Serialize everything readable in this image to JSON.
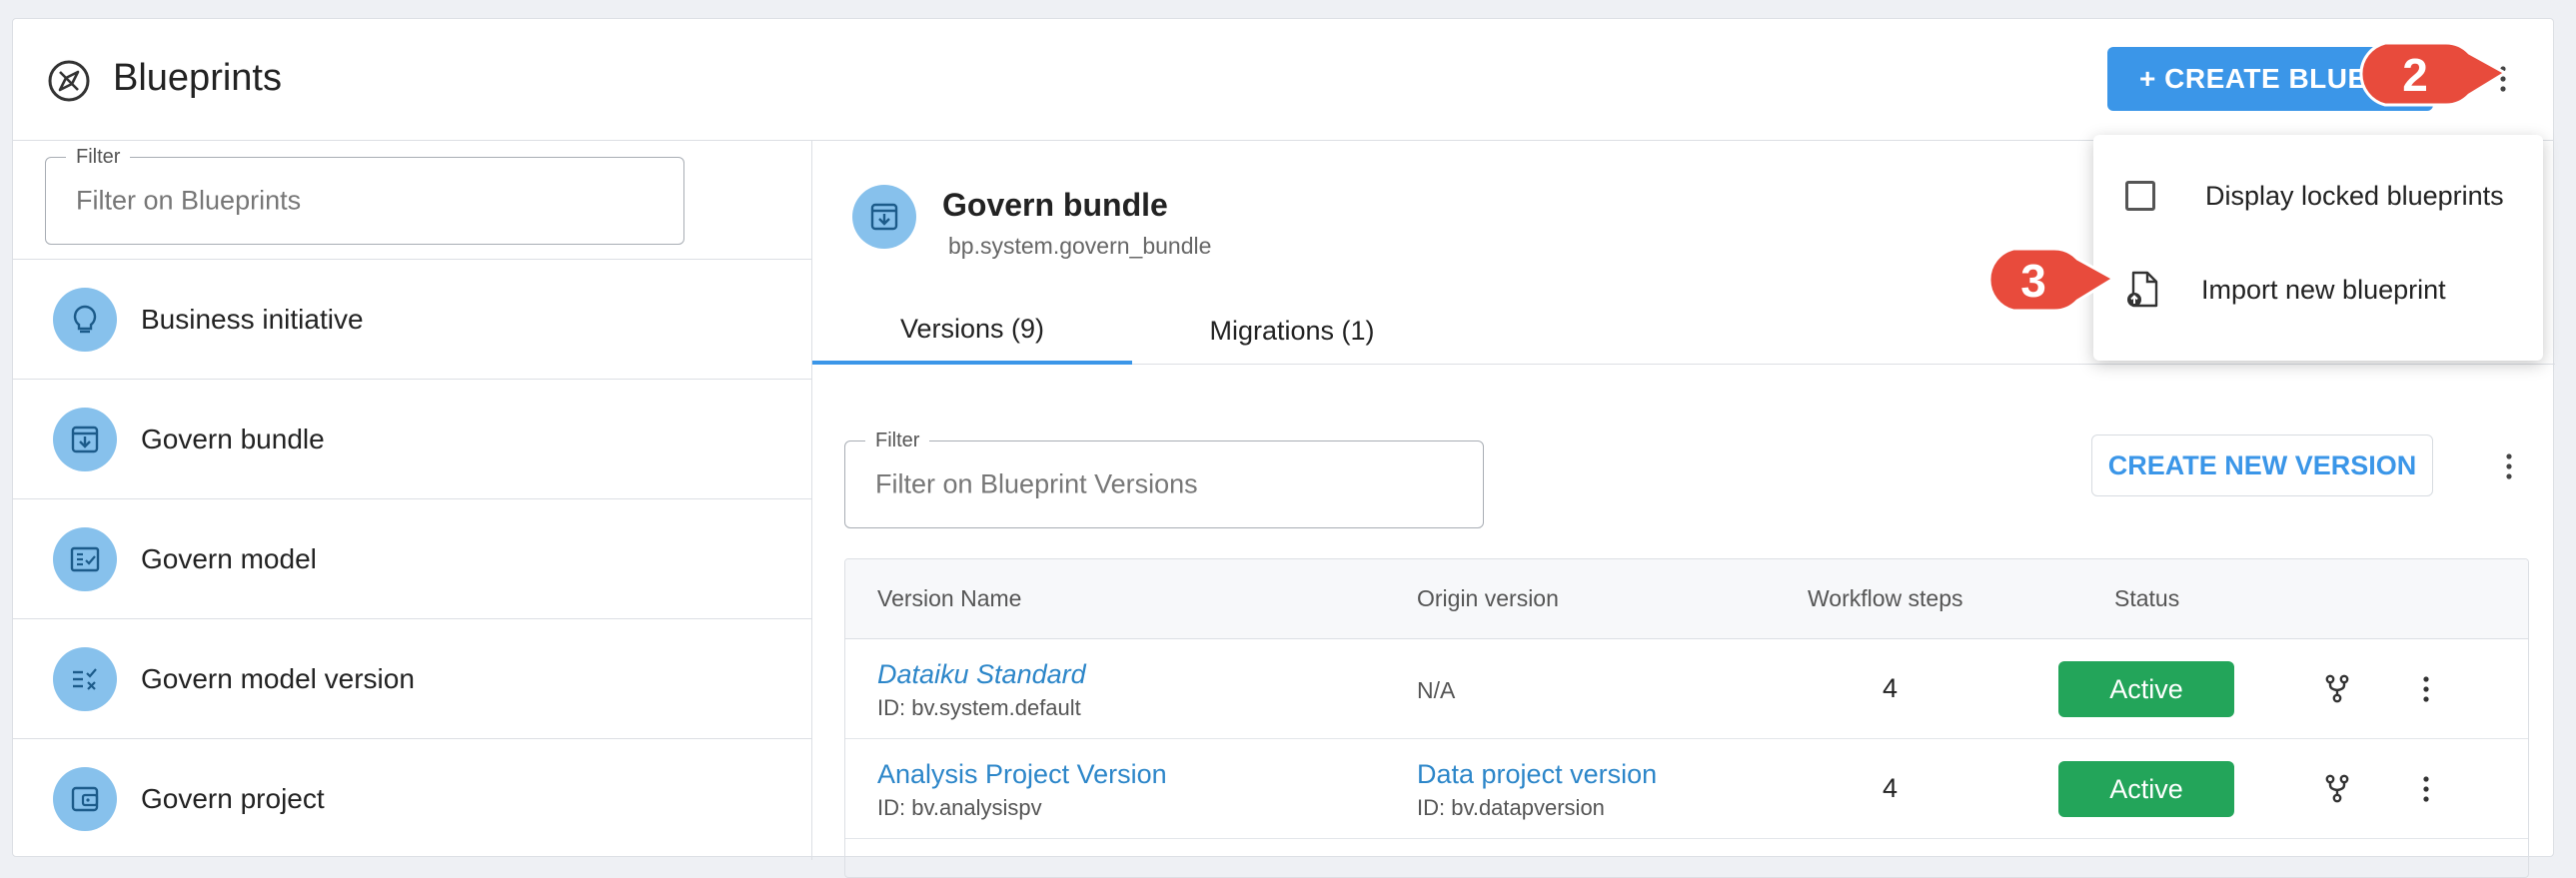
{
  "header": {
    "title": "Blueprints",
    "create_label": "+ CREATE BLUEPRINT"
  },
  "sidebar": {
    "filter_legend": "Filter",
    "filter_placeholder": "Filter on Blueprints",
    "items": [
      {
        "label": "Business initiative",
        "icon": "lightbulb-icon"
      },
      {
        "label": "Govern bundle",
        "icon": "bundle-icon"
      },
      {
        "label": "Govern model",
        "icon": "model-icon"
      },
      {
        "label": "Govern model version",
        "icon": "model-version-icon"
      },
      {
        "label": "Govern project",
        "icon": "project-icon"
      }
    ]
  },
  "main": {
    "title": "Govern bundle",
    "id": "bp.system.govern_bundle",
    "tabs": [
      {
        "label": "Versions (9)",
        "active": true
      },
      {
        "label": "Migrations (1)",
        "active": false
      }
    ],
    "filter_legend": "Filter",
    "filter_placeholder": "Filter on Blueprint Versions",
    "create_version_label": "CREATE NEW VERSION",
    "table": {
      "headers": [
        "Version Name",
        "Origin version",
        "Workflow steps",
        "Status"
      ],
      "rows": [
        {
          "name": "Dataiku Standard",
          "id": "ID: bv.system.default",
          "origin": "N/A",
          "origin_id": "",
          "steps": "4",
          "status": "Active"
        },
        {
          "name": "Analysis Project Version",
          "id": "ID: bv.analysispv",
          "origin": "Data project version",
          "origin_id": "ID: bv.datapversion",
          "steps": "4",
          "status": "Active"
        }
      ]
    }
  },
  "dropdown": {
    "display_locked": "Display locked blueprints",
    "import_new": "Import new blueprint"
  },
  "callouts": [
    "2",
    "3"
  ],
  "colors": {
    "accent": "#3b96e8",
    "active": "#23a55a",
    "callout": "#e84b3c",
    "icon_circle": "#87c1ec"
  }
}
